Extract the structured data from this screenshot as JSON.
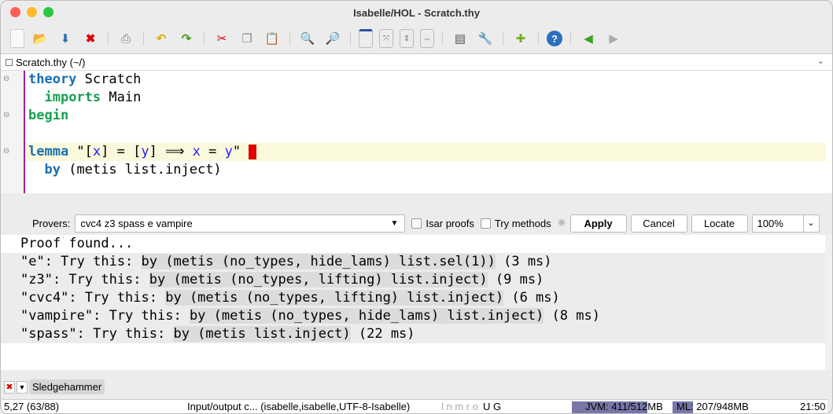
{
  "window_title": "Isabelle/HOL - Scratch.thy",
  "toolbar": {
    "icons": [
      "new-file-icon",
      "open-file-icon",
      "save-file-icon",
      "close-file-icon",
      "print-icon",
      "undo-icon",
      "redo-icon",
      "cut-icon",
      "copy-icon",
      "paste-icon",
      "find-icon",
      "find-replace-icon",
      "new-view-icon",
      "unsplit-icon",
      "split-horizontal-icon",
      "split-vertical-icon",
      "buffer-options-icon",
      "global-options-icon",
      "plugin-manager-icon",
      "help-icon",
      "back-icon",
      "forward-icon"
    ]
  },
  "file_tab": {
    "label": "Scratch.thy (~/)"
  },
  "editor": {
    "theory_kw": "theory",
    "theory_name": " Scratch",
    "imports_kw": "imports",
    "imports_name": " Main",
    "begin_kw": "begin",
    "lemma_kw": "lemma",
    "lemma_q1": " \"[",
    "lemma_x1": "x",
    "lemma_mid": "] = [",
    "lemma_y1": "y",
    "lemma_mid2": "] ⟹ ",
    "lemma_x2": "x",
    "lemma_eq": " = ",
    "lemma_y2": "y",
    "lemma_q2": "\"",
    "by_kw": "by",
    "by_rest": " (metis list.inject)"
  },
  "sledgehammer": {
    "provers_label": "Provers:",
    "provers_value": "cvc4 z3 spass e vampire",
    "isar_proofs_label": "Isar proofs",
    "try_methods_label": "Try methods",
    "apply_label": "Apply",
    "cancel_label": "Cancel",
    "locate_label": "Locate",
    "zoom_value": "100%"
  },
  "output": {
    "header": "Proof found...",
    "results": [
      {
        "prefix": "\"e\": Try this: ",
        "cmd": "by (metis (no_types, hide_lams) list.sel(1))",
        "time": " (3 ms)"
      },
      {
        "prefix": "\"z3\": Try this: ",
        "cmd": "by (metis (no_types, lifting) list.inject)",
        "time": " (9 ms)"
      },
      {
        "prefix": "\"cvc4\": Try this: ",
        "cmd": "by (metis (no_types, lifting) list.inject)",
        "time": " (6 ms)"
      },
      {
        "prefix": "\"vampire\": Try this: ",
        "cmd": "by (metis (no_types, hide_lams) list.inject)",
        "time": " (8 ms)"
      },
      {
        "prefix": "\"spass\": Try this: ",
        "cmd": "by (metis list.inject)",
        "time": " (22 ms)"
      }
    ]
  },
  "dock": {
    "tab_label": "Sledgehammer"
  },
  "status": {
    "position": "5,27 (63/88)",
    "mode": "Input/output c... (isabelle,isabelle,UTF-8-Isabelle)",
    "flags_dim": "l n m r o",
    "flags": "U G",
    "jvm": "JVM: 411/512MB",
    "jvm_fraction": 0.8,
    "ml": "ML: 207/948MB",
    "ml_fraction": 0.22,
    "time": "21:50"
  }
}
